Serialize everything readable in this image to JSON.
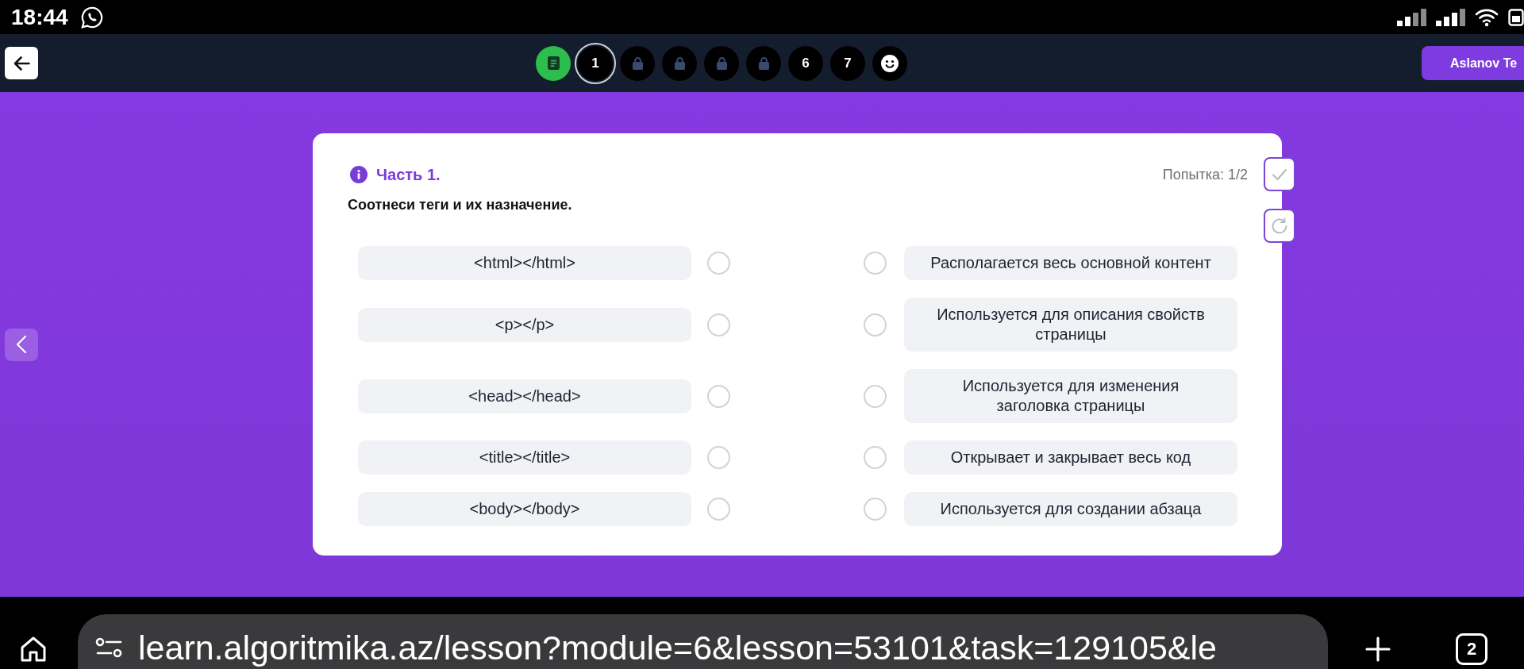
{
  "status_bar": {
    "time": "18:44"
  },
  "nav": {
    "steps": [
      {
        "kind": "completed",
        "selected": false
      },
      {
        "kind": "number",
        "label": "1",
        "selected": true
      },
      {
        "kind": "locked",
        "selected": false
      },
      {
        "kind": "locked",
        "selected": false
      },
      {
        "kind": "locked",
        "selected": false
      },
      {
        "kind": "locked",
        "selected": false
      },
      {
        "kind": "number",
        "label": "6",
        "selected": false
      },
      {
        "kind": "number",
        "label": "7",
        "selected": false
      },
      {
        "kind": "smile",
        "selected": false
      }
    ],
    "user": "Aslanov Te"
  },
  "task": {
    "part": "Часть 1.",
    "attempt": "Попытка: 1/2",
    "instruction": "Соотнеси теги и их назначение.",
    "left_items": [
      {
        "label": "<html></html>",
        "selected": false
      },
      {
        "label": "<p></p>",
        "selected": false
      },
      {
        "label": "<head></head>",
        "selected": false
      },
      {
        "label": "<title></title>",
        "selected": false
      },
      {
        "label": "<body></body>",
        "selected": false
      }
    ],
    "right_items": [
      {
        "label": "Располагается весь основной контент",
        "selected": false
      },
      {
        "label": "Используется для описания свойств страницы",
        "selected": false
      },
      {
        "label": "Используется для изменения заголовка страницы",
        "selected": false
      },
      {
        "label": "Открывает и закрывает весь код",
        "selected": false
      },
      {
        "label": "Используется для создании абзаца",
        "selected": false
      }
    ]
  },
  "browser": {
    "url": "learn.algoritmika.az/lesson?module=6&lesson=53101&task=129105&le",
    "tab_count": "2"
  }
}
